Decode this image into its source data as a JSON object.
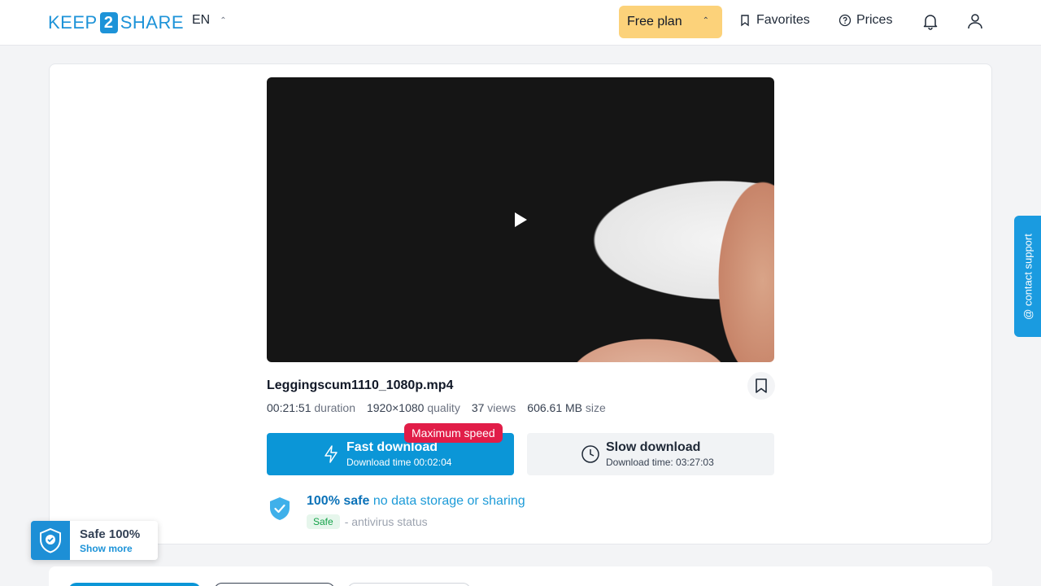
{
  "header": {
    "logo_left": "KEEP",
    "logo_num": "2",
    "logo_right": "SHARE",
    "lang": "EN",
    "plan": "Free plan",
    "favorites": "Favorites",
    "prices": "Prices"
  },
  "file": {
    "name": "Leggingscum1110_1080p.mp4",
    "duration_value": "00:21:51",
    "duration_label": "duration",
    "quality_value": "1920×1080",
    "quality_label": "quality",
    "views_value": "37",
    "views_label": "views",
    "size_value": "606.61 MB",
    "size_label": "size"
  },
  "download": {
    "fast_title": "Fast download",
    "fast_sub": "Download time 00:02:04",
    "badge": "Maximum speed",
    "slow_title": "Slow download",
    "slow_sub": "Download time: 03:27:03"
  },
  "safety": {
    "strong": "100% safe",
    "rest": "no data storage or sharing",
    "badge": "Safe",
    "status": "- antivirus status"
  },
  "float_badge": {
    "title": "Safe 100%",
    "link": "Show more"
  },
  "support": {
    "label": "@ contact support"
  },
  "colors": {
    "brand": "#1d93d8",
    "plan": "#fcd27a",
    "fast": "#0b96d7",
    "badge": "#e11d48"
  }
}
